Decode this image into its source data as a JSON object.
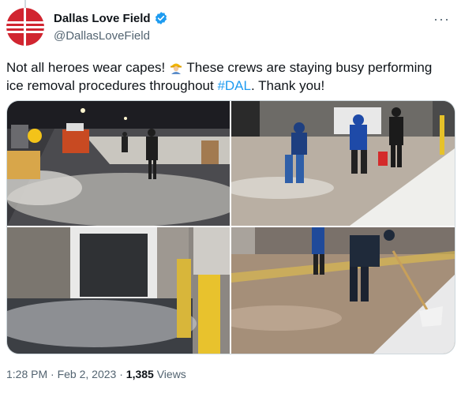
{
  "account": {
    "display_name": "Dallas Love Field",
    "handle": "@DallasLoveField",
    "verified": true
  },
  "tweet": {
    "text_before": "Not all heroes wear capes! ",
    "emoji_name": "construction-worker-emoji",
    "text_middle": " These crews are staying busy performing ice removal procedures throughout ",
    "hashtag": "#DAL",
    "text_after": ". Thank you!"
  },
  "media": [
    {
      "name": "photo-night-ramp-crew"
    },
    {
      "name": "photo-crew-salting-ice"
    },
    {
      "name": "photo-snowplow-closeup"
    },
    {
      "name": "photo-worker-shoveling"
    }
  ],
  "meta": {
    "time": "1:28 PM",
    "separator": "·",
    "date": "Feb 2, 2023",
    "views_count": "1,385",
    "views_label": "Views"
  },
  "colors": {
    "link": "#1d9bf0",
    "brand_red": "#d12530",
    "muted": "#536471"
  }
}
